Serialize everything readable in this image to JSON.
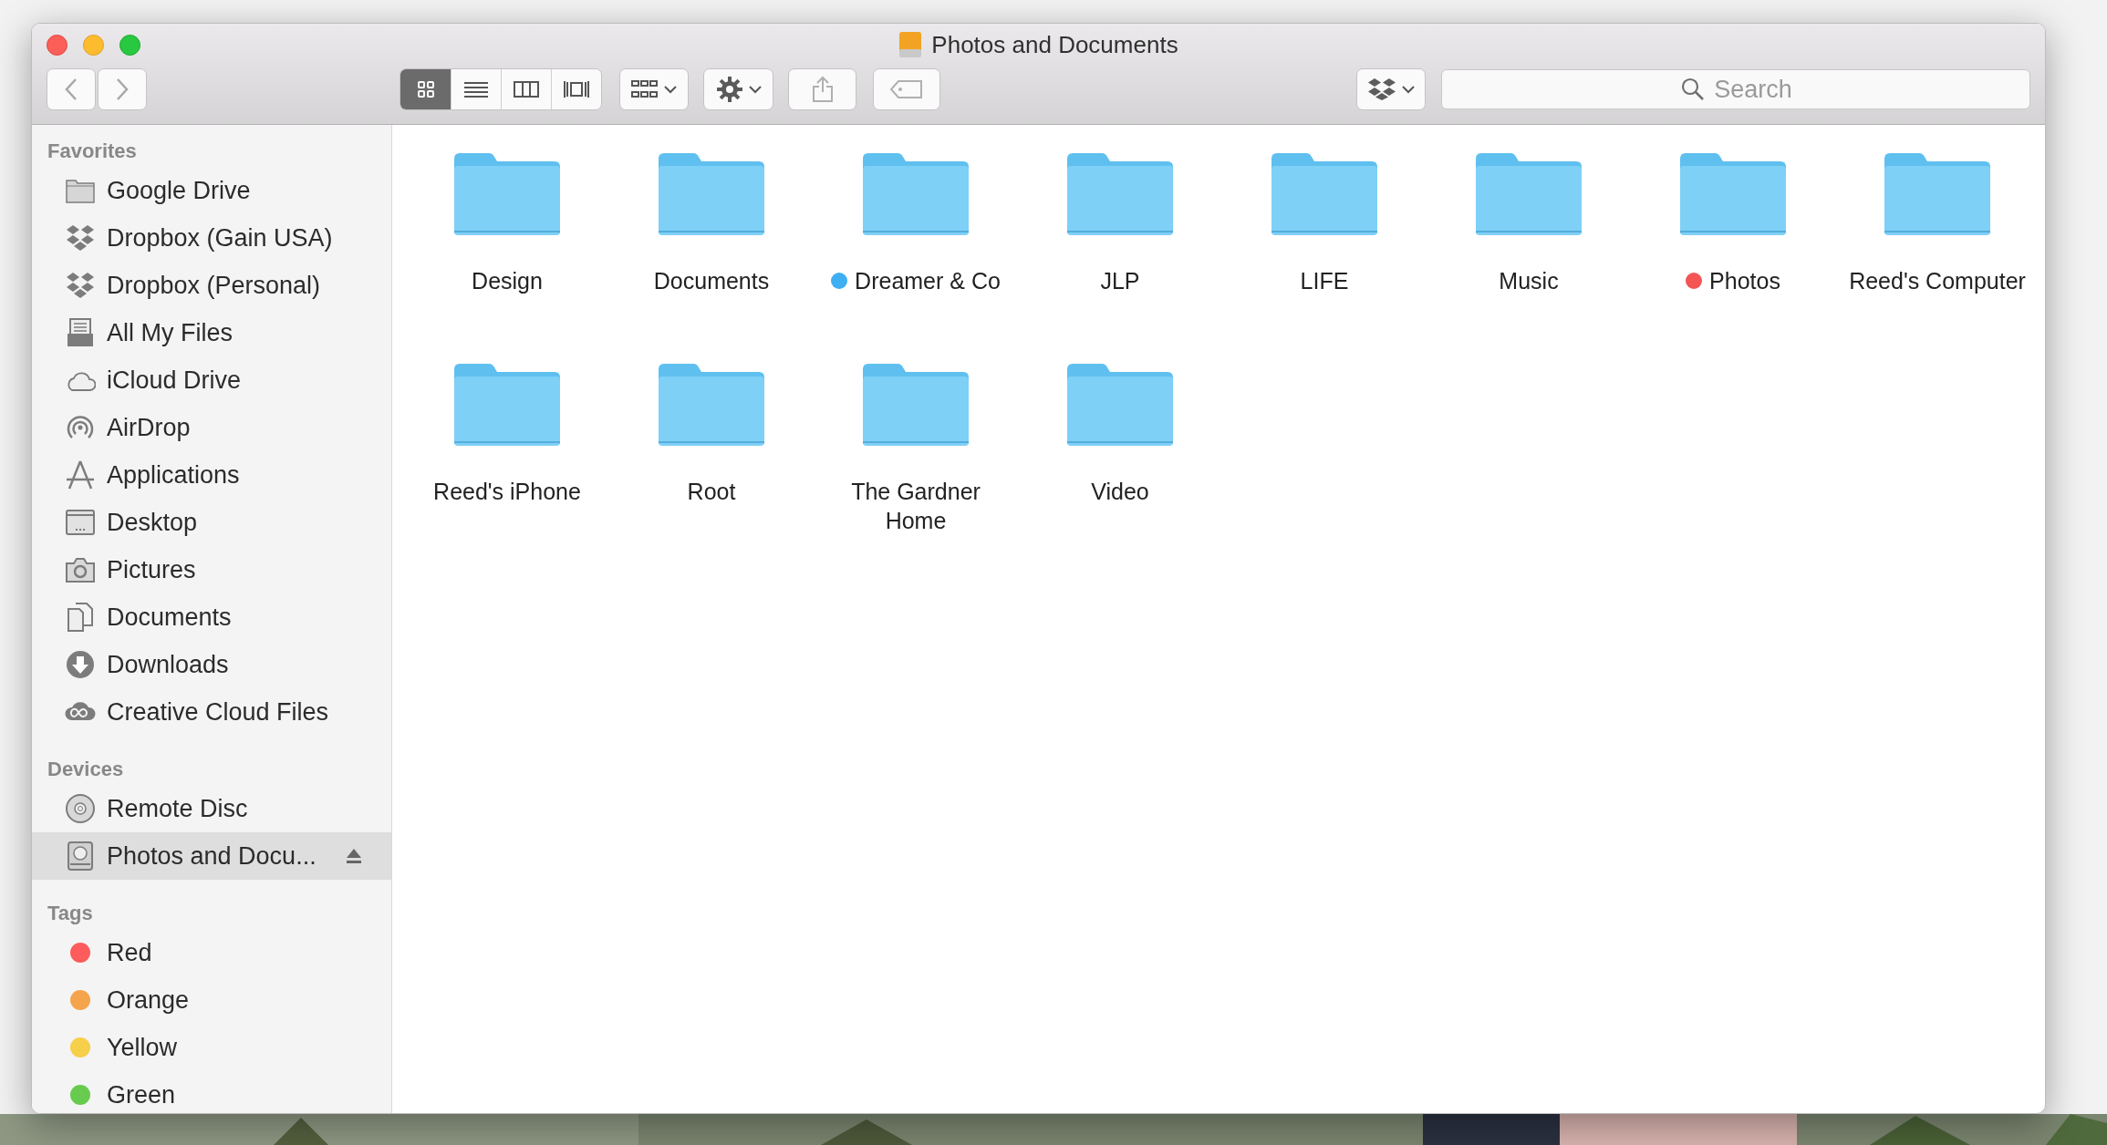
{
  "window": {
    "title": "Photos and Documents"
  },
  "toolbar": {
    "view_modes": [
      {
        "selected": true
      },
      {
        "selected": false
      },
      {
        "selected": false
      },
      {
        "selected": false
      }
    ],
    "search": {
      "placeholder": "Search"
    }
  },
  "sidebar": [
    {
      "heading": "Favorites",
      "items": [
        {
          "label": "Google Drive",
          "selected": false
        },
        {
          "label": "Dropbox (Gain USA)",
          "selected": false
        },
        {
          "label": "Dropbox (Personal)",
          "selected": false
        },
        {
          "label": "All My Files",
          "selected": false
        },
        {
          "label": "iCloud Drive",
          "selected": false
        },
        {
          "label": "AirDrop",
          "selected": false
        },
        {
          "label": "Applications",
          "selected": false
        },
        {
          "label": "Desktop",
          "selected": false
        },
        {
          "label": "Pictures",
          "selected": false
        },
        {
          "label": "Documents",
          "selected": false
        },
        {
          "label": "Downloads",
          "selected": false
        },
        {
          "label": "Creative Cloud Files",
          "selected": false
        }
      ]
    },
    {
      "heading": "Devices",
      "items": [
        {
          "label": "Remote Disc",
          "selected": false
        },
        {
          "label": "Photos and Docu...",
          "selected": true,
          "ejectable": true
        }
      ]
    },
    {
      "heading": "Tags",
      "items": [
        {
          "label": "Red",
          "selected": false,
          "color": "#fc5c5c"
        },
        {
          "label": "Orange",
          "selected": false,
          "color": "#f5a44e"
        },
        {
          "label": "Yellow",
          "selected": false,
          "color": "#f6cf4b"
        },
        {
          "label": "Green",
          "selected": false,
          "color": "#68cb4f"
        }
      ]
    }
  ],
  "folders": [
    {
      "name": "Design"
    },
    {
      "name": "Documents"
    },
    {
      "name": "Dreamer & Co",
      "color": "#3eaff2"
    },
    {
      "name": "JLP"
    },
    {
      "name": "LIFE"
    },
    {
      "name": "Music"
    },
    {
      "name": "Photos",
      "color": "#f45454"
    },
    {
      "name": "Reed's Computer"
    },
    {
      "name": "Reed's iPhone"
    },
    {
      "name": "Root"
    },
    {
      "name": "The Gardner Home"
    },
    {
      "name": "Video"
    }
  ]
}
